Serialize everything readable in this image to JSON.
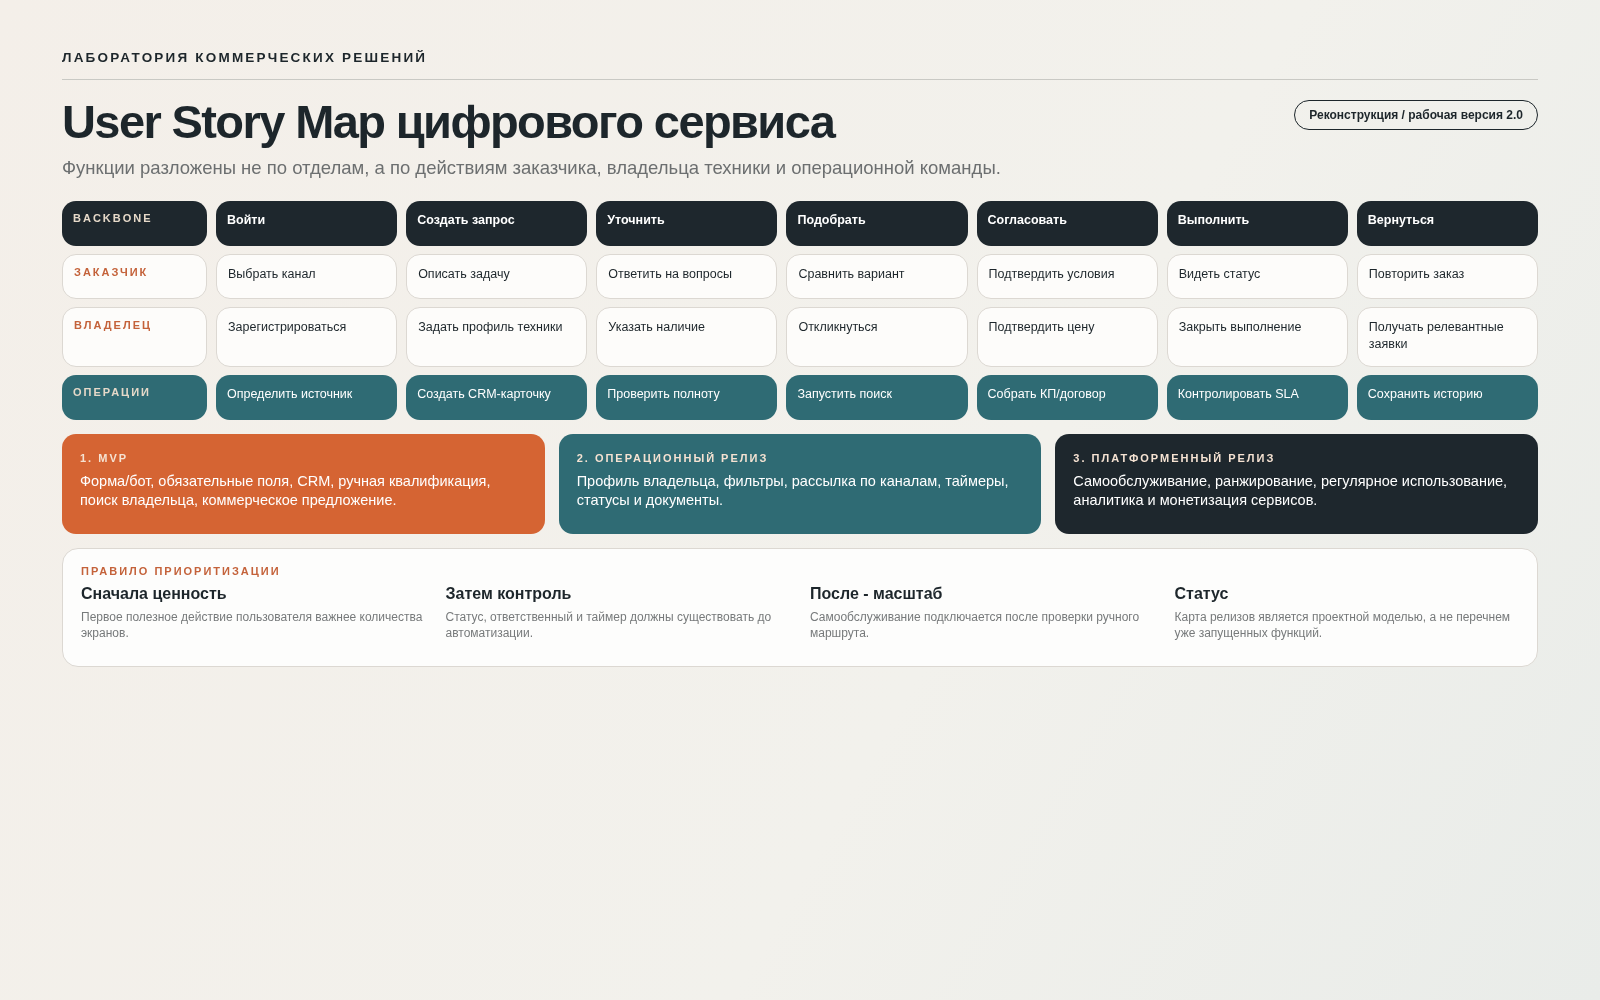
{
  "header": {
    "eyebrow": "ЛАБОРАТОРИЯ КОММЕРЧЕСКИХ РЕШЕНИЙ",
    "title": "User Story Map цифрового сервиса",
    "subtitle": "Функции разложены не по отделам, а по действиям заказчика, владельца техники и операционной команды.",
    "badge": "Реконструкция / рабочая версия 2.0"
  },
  "lanes": [
    {
      "kind": "backbone",
      "label": "BACKBONE",
      "cells": [
        "Войти",
        "Создать запрос",
        "Уточнить",
        "Подобрать",
        "Согласовать",
        "Выполнить",
        "Вернуться"
      ]
    },
    {
      "kind": "persona",
      "label": "ЗАКАЗЧИК",
      "cells": [
        "Выбрать канал",
        "Описать задачу",
        "Ответить на вопросы",
        "Сравнить вариант",
        "Подтвердить условия",
        "Видеть статус",
        "Повторить заказ"
      ]
    },
    {
      "kind": "persona",
      "label": "ВЛАДЕЛЕЦ",
      "cells": [
        "Зарегистрироваться",
        "Задать профиль техники",
        "Указать наличие",
        "Откликнуться",
        "Подтвердить цену",
        "Закрыть выполнение",
        "Получать релевантные заявки"
      ]
    },
    {
      "kind": "operations",
      "label": "ОПЕРАЦИИ",
      "cells": [
        "Определить источник",
        "Создать CRM-карточку",
        "Проверить полноту",
        "Запустить поиск",
        "Собрать КП/договор",
        "Контролировать SLA",
        "Сохранить историю"
      ]
    }
  ],
  "releases": [
    {
      "kind": "mvp",
      "title": "1. MVP",
      "text": "Форма/бот, обязательные поля, CRM, ручная квалификация, поиск владельца, коммерческое предложение."
    },
    {
      "kind": "operational",
      "title": "2. ОПЕРАЦИОННЫЙ РЕЛИЗ",
      "text": "Профиль владельца, фильтры, рассылка по каналам, таймеры, статусы и документы."
    },
    {
      "kind": "platform",
      "title": "3. ПЛАТФОРМЕННЫЙ РЕЛИЗ",
      "text": "Самообслуживание, ранжирование, регулярное использование, аналитика и монетизация сервисов."
    }
  ],
  "rules": {
    "title": "ПРАВИЛО ПРИОРИТИЗАЦИИ",
    "items": [
      {
        "heading": "Сначала ценность",
        "text": "Первое полезное действие пользователя важнее количества экранов."
      },
      {
        "heading": "Затем контроль",
        "text": "Статус, ответственный и таймер должны существовать до автоматизации."
      },
      {
        "heading": "После - масштаб",
        "text": "Самообслуживание подключается после проверки ручного маршрута."
      },
      {
        "heading": "Статус",
        "text": "Карта релизов является проектной моделью, а не перечнем уже запущенных функций."
      }
    ]
  }
}
